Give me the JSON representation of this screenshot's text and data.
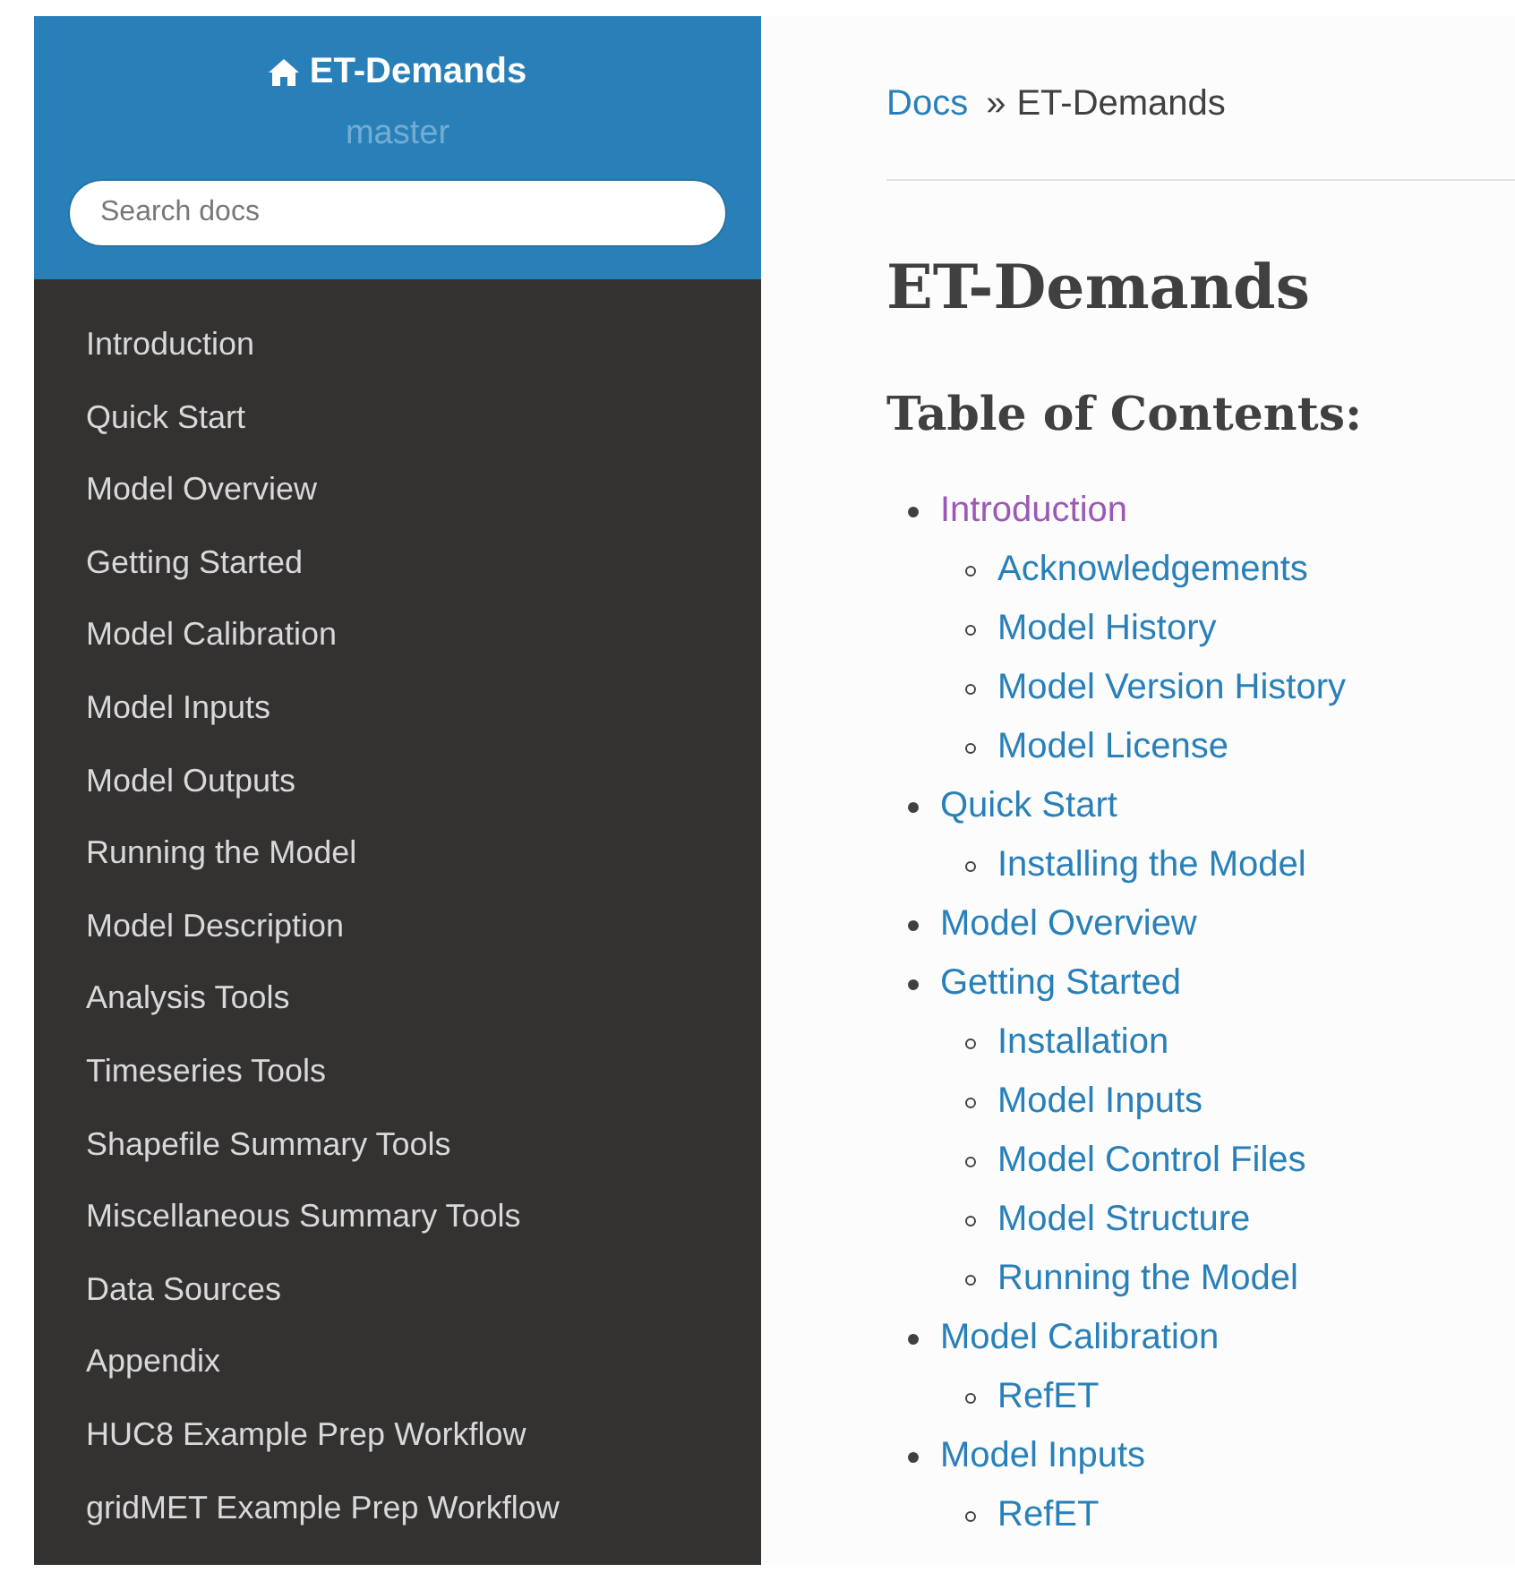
{
  "sidebar": {
    "project": "ET-Demands",
    "version": "master",
    "search": {
      "placeholder": "Search docs"
    },
    "items": [
      {
        "label": "Introduction"
      },
      {
        "label": "Quick Start"
      },
      {
        "label": "Model Overview"
      },
      {
        "label": "Getting Started"
      },
      {
        "label": "Model Calibration"
      },
      {
        "label": "Model Inputs"
      },
      {
        "label": "Model Outputs"
      },
      {
        "label": "Running the Model"
      },
      {
        "label": "Model Description"
      },
      {
        "label": "Analysis Tools"
      },
      {
        "label": "Timeseries Tools"
      },
      {
        "label": "Shapefile Summary Tools"
      },
      {
        "label": "Miscellaneous Summary Tools"
      },
      {
        "label": "Data Sources"
      },
      {
        "label": "Appendix"
      },
      {
        "label": "HUC8 Example Prep Workflow"
      },
      {
        "label": "gridMET Example Prep Workflow"
      }
    ]
  },
  "breadcrumb": {
    "link": "Docs",
    "separator": "»",
    "current": "ET-Demands"
  },
  "title": "ET-Demands",
  "toc_heading": "Table of Contents:",
  "toc": [
    {
      "label": "Introduction",
      "visited": true,
      "children": [
        {
          "label": "Acknowledgements",
          "visited": false
        },
        {
          "label": "Model History",
          "visited": false
        },
        {
          "label": "Model Version History",
          "visited": false
        },
        {
          "label": "Model License",
          "visited": false
        }
      ]
    },
    {
      "label": "Quick Start",
      "visited": false,
      "children": [
        {
          "label": "Installing the Model",
          "visited": false
        }
      ]
    },
    {
      "label": "Model Overview",
      "visited": false
    },
    {
      "label": "Getting Started",
      "visited": false,
      "children": [
        {
          "label": "Installation",
          "visited": false
        },
        {
          "label": "Model Inputs",
          "visited": false
        },
        {
          "label": "Model Control Files",
          "visited": false
        },
        {
          "label": "Model Structure",
          "visited": false
        },
        {
          "label": "Running the Model",
          "visited": false
        }
      ]
    },
    {
      "label": "Model Calibration",
      "visited": false,
      "children": [
        {
          "label": "RefET",
          "visited": false
        }
      ]
    },
    {
      "label": "Model Inputs",
      "visited": false,
      "children": [
        {
          "label": "RefET",
          "visited": false
        }
      ]
    }
  ]
}
